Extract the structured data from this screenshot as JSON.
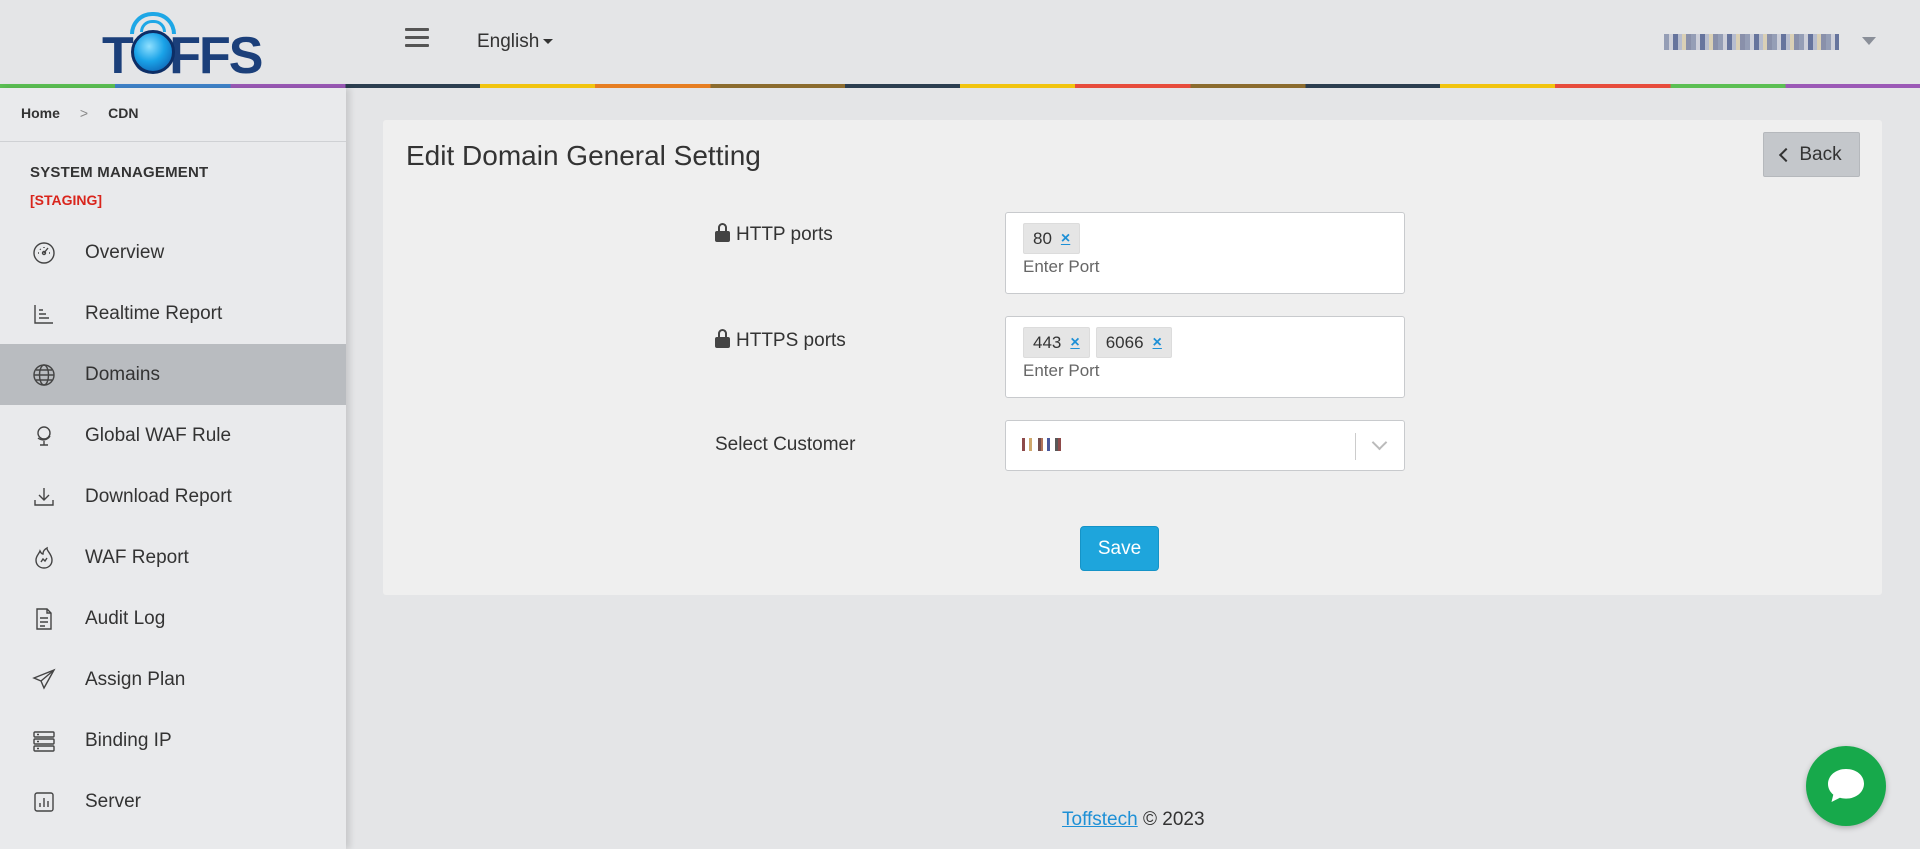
{
  "header": {
    "logo_text": "TOFFS",
    "language": "English",
    "user_email": "████████████████"
  },
  "sidebar": {
    "breadcrumb": [
      "Home",
      "CDN"
    ],
    "section_title": "SYSTEM MANAGEMENT",
    "environment_badge": "[STAGING]",
    "items": [
      {
        "label": "Overview",
        "icon": "dashboard-gauge-icon"
      },
      {
        "label": "Realtime Report",
        "icon": "bar-chart-icon"
      },
      {
        "label": "Domains",
        "icon": "globe-icon",
        "active": true
      },
      {
        "label": "Global WAF Rule",
        "icon": "globe-stand-icon"
      },
      {
        "label": "Download Report",
        "icon": "download-icon"
      },
      {
        "label": "WAF Report",
        "icon": "flame-icon"
      },
      {
        "label": "Audit Log",
        "icon": "document-icon"
      },
      {
        "label": "Assign Plan",
        "icon": "paper-plane-icon"
      },
      {
        "label": "Binding IP",
        "icon": "server-stack-icon"
      },
      {
        "label": "Server",
        "icon": "chart-square-icon"
      }
    ]
  },
  "main": {
    "title": "Edit Domain General Setting",
    "back_label": "Back",
    "http_label": "HTTP ports",
    "http_ports": [
      "80"
    ],
    "https_label": "HTTPS ports",
    "https_ports": [
      "443",
      "6066"
    ],
    "port_placeholder": "Enter Port",
    "customer_label": "Select Customer",
    "save_label": "Save"
  },
  "footer": {
    "company": "Toffstech",
    "copyright": "© 2023"
  },
  "colors": {
    "primary_button": "#1ea5dc",
    "staging_red": "#d9251c",
    "chat_green": "#17a94b"
  }
}
